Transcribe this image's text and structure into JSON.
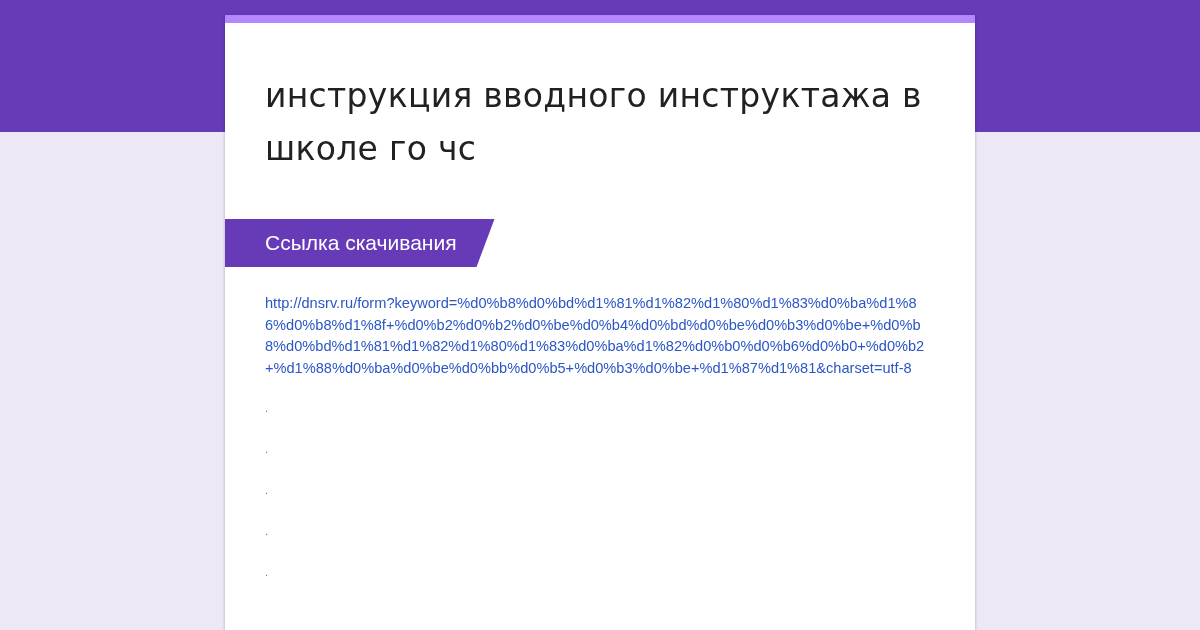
{
  "form": {
    "title": "инструкция вводного инструктажа в школе го чс",
    "section": {
      "title": "Ссылка скачивания"
    },
    "link": "http://dnsrv.ru/form?keyword=%d0%b8%d0%bd%d1%81%d1%82%d1%80%d1%83%d0%ba%d1%86%d0%b8%d1%8f+%d0%b2%d0%b2%d0%be%d0%b4%d0%bd%d0%be%d0%b3%d0%be+%d0%b8%d0%bd%d1%81%d1%82%d1%80%d1%83%d0%ba%d1%82%d0%b0%d0%b6%d0%b0+%d0%b2+%d1%88%d0%ba%d0%be%d0%bb%d0%b5+%d0%b3%d0%be+%d1%87%d1%81&charset=utf-8",
    "lines": [
      ".",
      ".",
      ".",
      ".",
      "."
    ]
  }
}
